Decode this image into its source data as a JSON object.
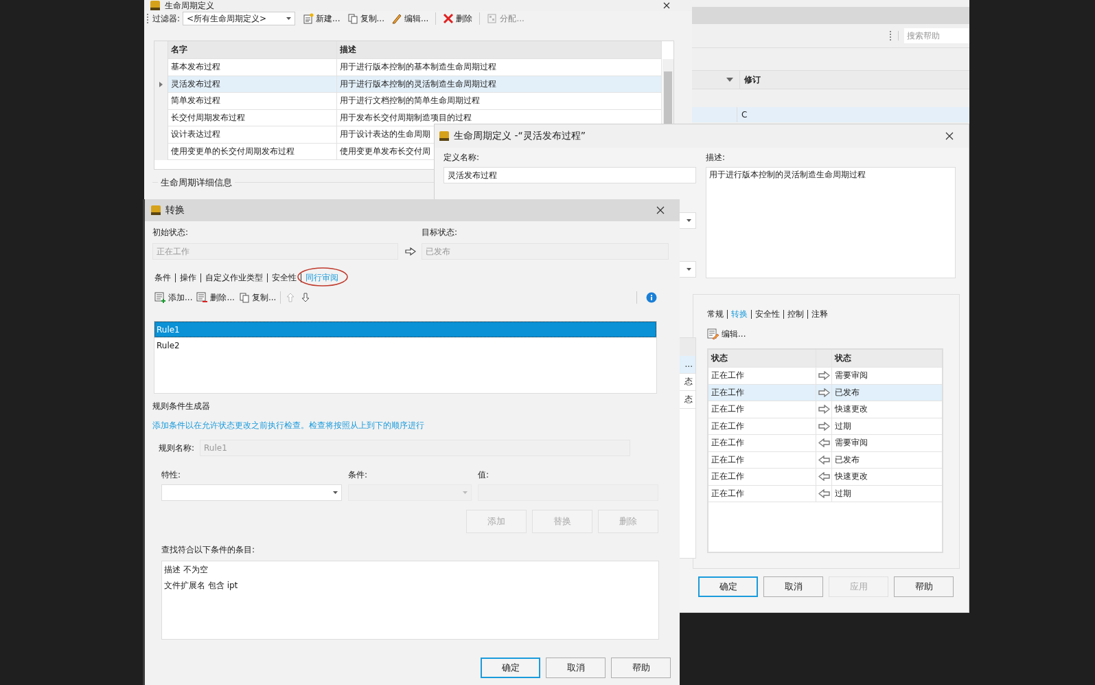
{
  "lifecycle_window": {
    "title": "生命周期定义",
    "filter": {
      "label": "过滤器:",
      "value": "<所有生命周期定义>"
    },
    "toolbar": [
      {
        "label": "新建...",
        "disabled": false
      },
      {
        "label": "复制...",
        "disabled": false
      },
      {
        "label": "编辑...",
        "disabled": false
      },
      {
        "label": "删除",
        "disabled": false
      },
      {
        "label": "分配...",
        "disabled": true
      }
    ],
    "table": {
      "columns": [
        "名字",
        "描述"
      ],
      "rows": [
        {
          "name": "基本发布过程",
          "description": "用于进行版本控制的基本制造生命周期过程",
          "selected": false
        },
        {
          "name": "灵活发布过程",
          "description": "用于进行版本控制的灵活制造生命周期过程",
          "selected": true
        },
        {
          "name": "简单发布过程",
          "description": "用于进行文档控制的简单生命周期过程",
          "selected": false
        },
        {
          "name": "长交付周期发布过程",
          "description": "用于发布长交付周期制造项目的过程",
          "selected": false
        },
        {
          "name": "设计表达过程",
          "description": "用于设计表达的生命周期",
          "selected": false
        },
        {
          "name": "使用变更单的长交付周期发布过程",
          "description": "使用变更单发布长交付周",
          "selected": false
        }
      ]
    },
    "details_group": "生命周期详细信息"
  },
  "background_app": {
    "search": {
      "placeholder": "搜索帮助"
    },
    "table": {
      "columns": [
        "修订"
      ],
      "rows": [
        {
          "revision": "C",
          "selected": true
        }
      ]
    }
  },
  "definition_dialog": {
    "title": "生命周期定义 -“灵活发布过程”",
    "name_field": {
      "label": "定义名称:",
      "value": "灵活发布过程"
    },
    "description_field": {
      "label": "描述:",
      "value": "用于进行版本控制的灵活制造生命周期过程"
    },
    "tabs": [
      {
        "label": "常规",
        "selected": false
      },
      {
        "label": "转换",
        "selected": true
      },
      {
        "label": "安全性",
        "selected": false
      },
      {
        "label": "控制",
        "selected": false
      },
      {
        "label": "注释",
        "selected": false
      }
    ],
    "edit_button": "编辑...",
    "partial_list": [
      {
        "text": "...",
        "selected": true
      },
      {
        "text": "态",
        "selected": false
      },
      {
        "text": "态",
        "selected": false
      }
    ],
    "transitions": {
      "columns": [
        "状态",
        "状态"
      ],
      "rows": [
        {
          "from": "正在工作",
          "reverse": false,
          "to": "需要审阅",
          "selected": false
        },
        {
          "from": "正在工作",
          "reverse": false,
          "to": "已发布",
          "selected": true
        },
        {
          "from": "正在工作",
          "reverse": false,
          "to": "快速更改",
          "selected": false
        },
        {
          "from": "正在工作",
          "reverse": false,
          "to": "过期",
          "selected": false
        },
        {
          "from": "正在工作",
          "reverse": true,
          "to": "需要审阅",
          "selected": false
        },
        {
          "from": "正在工作",
          "reverse": true,
          "to": "已发布",
          "selected": false
        },
        {
          "from": "正在工作",
          "reverse": true,
          "to": "快速更改",
          "selected": false
        },
        {
          "from": "正在工作",
          "reverse": true,
          "to": "过期",
          "selected": false
        }
      ]
    },
    "buttons": [
      {
        "label": "确定",
        "default": true,
        "disabled": false
      },
      {
        "label": "取消",
        "default": false,
        "disabled": false
      },
      {
        "label": "应用",
        "default": false,
        "disabled": true
      },
      {
        "label": "帮助",
        "default": false,
        "disabled": false
      }
    ]
  },
  "transition_dialog": {
    "title": "转换",
    "from_field": {
      "label": "初始状态:",
      "value": "正在工作",
      "disabled": true
    },
    "to_field": {
      "label": "目标状态:",
      "value": "已发布",
      "disabled": true
    },
    "tabs": [
      {
        "label": "条件",
        "selected": false,
        "circled": false
      },
      {
        "label": "操作",
        "selected": false,
        "circled": false
      },
      {
        "label": "自定义作业类型",
        "selected": false,
        "circled": false
      },
      {
        "label": "安全性",
        "selected": false,
        "circled": false
      },
      {
        "label": "同行审阅",
        "selected": true,
        "circled": true
      }
    ],
    "toolbar": [
      {
        "label": "添加..."
      },
      {
        "label": "删除..."
      },
      {
        "label": "复制..."
      }
    ],
    "rules": [
      {
        "name": "Rule1",
        "selected": true
      },
      {
        "name": "Rule2",
        "selected": false
      }
    ],
    "builder_title": "规则条件生成器",
    "hint": "添加条件以在允许状态更改之前执行检查。检查将按照从上到下的顺序进行",
    "rule_name_field": {
      "label": "规则名称:",
      "value": "Rule1",
      "disabled": true
    },
    "property_field": {
      "label": "特性:",
      "disabled": false
    },
    "condition_field": {
      "label": "条件:",
      "disabled": true
    },
    "value_field": {
      "label": "值:",
      "disabled": true
    },
    "condition_buttons": [
      {
        "label": "添加",
        "disabled": true
      },
      {
        "label": "替换",
        "disabled": true
      },
      {
        "label": "删除",
        "disabled": true
      }
    ],
    "criteria_label": "查找符合以下条件的条目:",
    "criteria": [
      "描述 不为空",
      "文件扩展名 包含 ipt"
    ],
    "buttons": [
      {
        "label": "确定",
        "default": true
      },
      {
        "label": "取消",
        "default": false
      },
      {
        "label": "帮助",
        "default": false
      }
    ]
  }
}
